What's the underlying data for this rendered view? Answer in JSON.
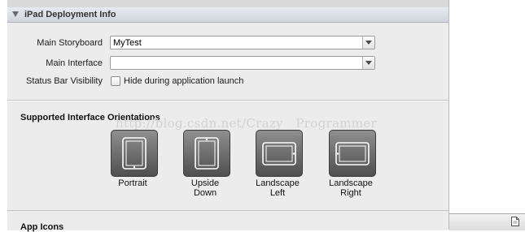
{
  "section": {
    "title": "iPad Deployment Info"
  },
  "fields": {
    "main_storyboard": {
      "label": "Main Storyboard",
      "value": "MyTest"
    },
    "main_interface": {
      "label": "Main Interface",
      "value": ""
    },
    "status_bar": {
      "label": "Status Bar Visibility",
      "checkbox_label": "Hide during application launch",
      "checked": false
    }
  },
  "orientations": {
    "heading": "Supported Interface Orientations",
    "items": [
      {
        "label_line1": "Portrait",
        "label_line2": ""
      },
      {
        "label_line1": "Upside",
        "label_line2": "Down"
      },
      {
        "label_line1": "Landscape",
        "label_line2": "Left"
      },
      {
        "label_line1": "Landscape",
        "label_line2": "Right"
      }
    ]
  },
  "watermark": "http://blog.csdn.net/Crazy__Programmer",
  "next_section": {
    "title": "App Icons"
  },
  "icons": {
    "section_toggle": "disclosure-triangle-icon",
    "combo_arrow": "chevron-down-icon",
    "status_doc": "document-icon"
  }
}
